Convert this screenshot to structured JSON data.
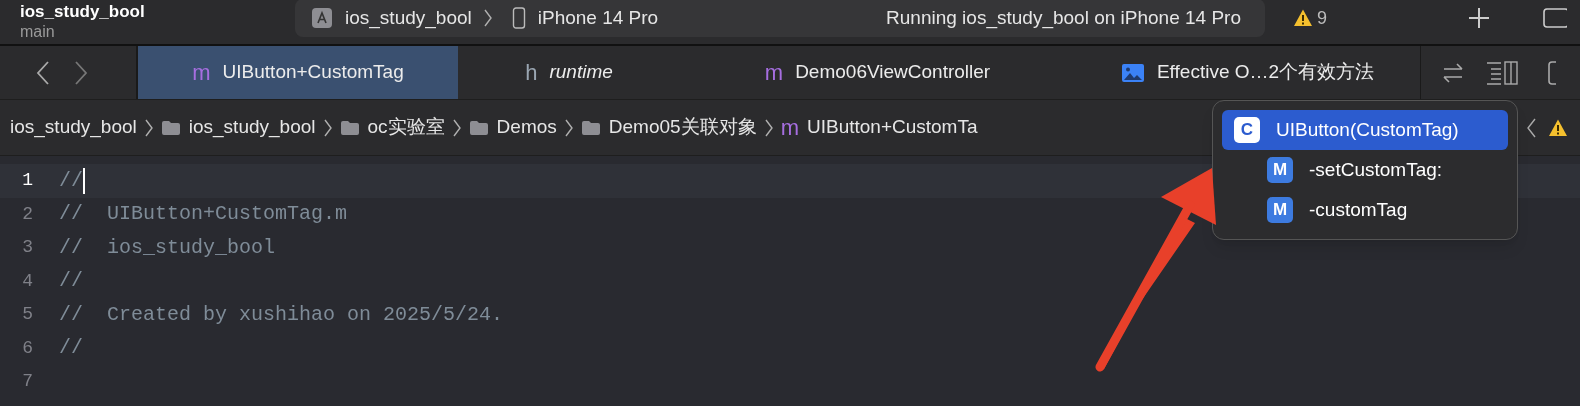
{
  "toolbar": {
    "project_title": "ios_study_bool",
    "branch": "main",
    "scheme": [
      {
        "label": "ios_study_bool",
        "kind": "app"
      },
      {
        "label": "iPhone 14 Pro",
        "kind": "device"
      }
    ],
    "status": "Running ios_study_bool on iPhone 14 Pro",
    "warnings": "9"
  },
  "tabs": [
    {
      "label": "UIButton+CustomTag",
      "glyph": "m",
      "kind": "implementation",
      "italic": false,
      "selected": true
    },
    {
      "label": "runtime",
      "glyph": "h",
      "kind": "header",
      "italic": true,
      "selected": false
    },
    {
      "label": "Demo06ViewController",
      "glyph": "m",
      "kind": "implementation",
      "italic": false,
      "selected": false
    },
    {
      "label": "Effective O…2个有效方法",
      "kind": "image",
      "italic": false,
      "selected": false
    }
  ],
  "breadcrumbs": [
    {
      "label": "ios_study_bool",
      "kind": "project"
    },
    {
      "label": "ios_study_bool",
      "kind": "folder"
    },
    {
      "label": "oc实验室",
      "kind": "folder"
    },
    {
      "label": "Demos",
      "kind": "folder"
    },
    {
      "label": "Demo05关联对象",
      "kind": "folder"
    },
    {
      "label": "UIButton+CustomTa",
      "kind": "file",
      "glyph": "m"
    }
  ],
  "code_lines": [
    {
      "number": "1",
      "text": "//",
      "current": true
    },
    {
      "number": "2",
      "text": "//  UIButton+CustomTag.m",
      "current": false
    },
    {
      "number": "3",
      "text": "//  ios_study_bool",
      "current": false
    },
    {
      "number": "4",
      "text": "//",
      "current": false
    },
    {
      "number": "5",
      "text": "//  Created by xushihao on 2025/5/24.",
      "current": false
    },
    {
      "number": "6",
      "text": "//",
      "current": false
    },
    {
      "number": "7",
      "current": false
    }
  ],
  "symbol_menu": {
    "items": [
      {
        "label": "UIButton(CustomTag)",
        "badge": "C",
        "selected": true,
        "children": [
          {
            "label": "-setCustomTag:",
            "badge": "M",
            "selected": false
          },
          {
            "label": "-customTag",
            "badge": "M",
            "selected": false
          }
        ]
      }
    ]
  }
}
